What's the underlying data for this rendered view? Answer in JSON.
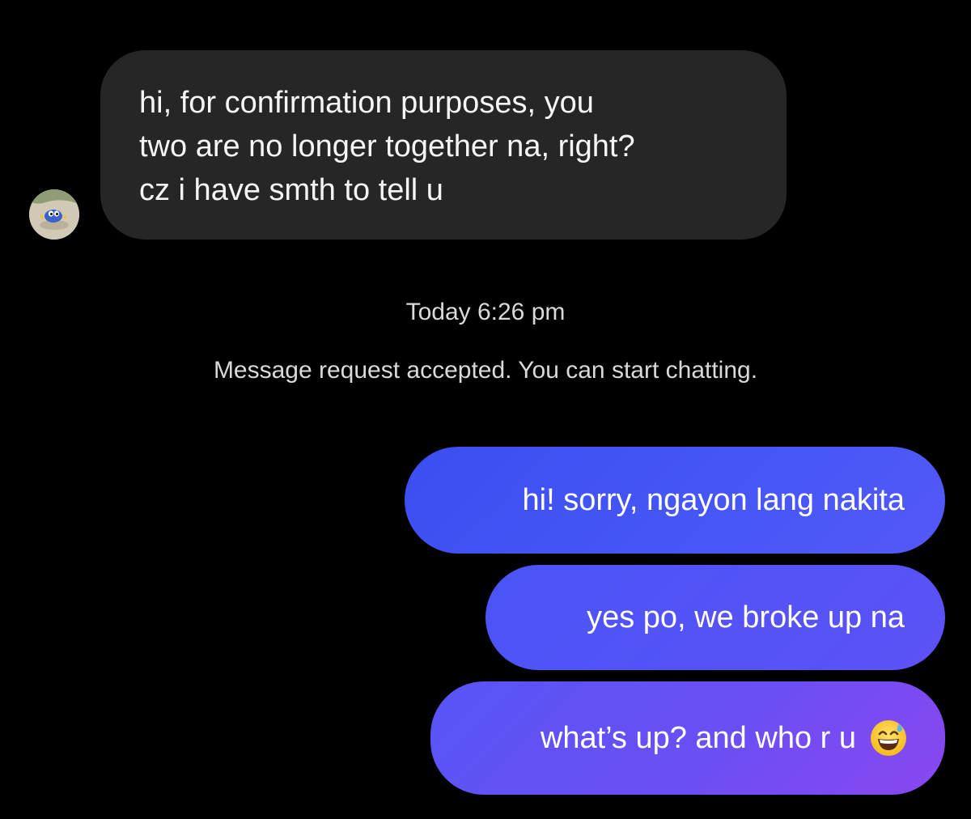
{
  "conversation": {
    "incoming": {
      "lines": [
        "hi, for confirmation purposes, you",
        "two are no longer together na, right?",
        "cz i have smth to tell u"
      ],
      "avatar_icon": "finned-creature-avatar-icon"
    },
    "timestamp": "Today 6:26 pm",
    "system_note": "Message request accepted. You can start chatting.",
    "outgoing": [
      {
        "text": "hi! sorry, ngayon lang nakita"
      },
      {
        "text": "yes po, we broke up na"
      },
      {
        "text": "what’s up? and who r u",
        "emoji": "grinning-face-with-sweat-icon"
      }
    ]
  },
  "colors": {
    "background": "#000000",
    "incoming_bubble": "#262626",
    "outgoing_gradient_start": "#3b4ef0",
    "outgoing_gradient_end": "#8a47ef",
    "meta_text": "#d9d9d9"
  }
}
